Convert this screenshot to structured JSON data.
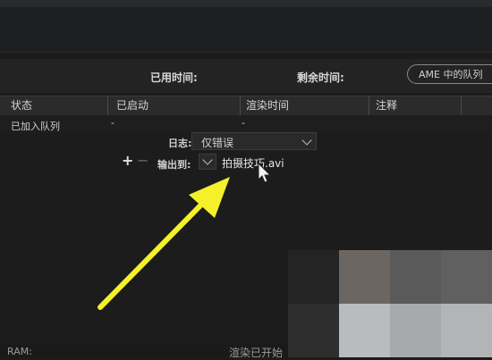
{
  "times": {
    "elapsed_label": "已用时间:",
    "remaining_label": "剩余时间:"
  },
  "ame_button": "AME 中的队列",
  "columns": [
    "状态",
    "已启动",
    "渲染时间",
    "注释"
  ],
  "row": {
    "status": "已加入队列",
    "started": "-",
    "render_time": "-"
  },
  "log": {
    "label": "日志:",
    "value": "仅错误"
  },
  "output": {
    "label": "输出到:",
    "filename": "拍摄技巧.avi"
  },
  "add_label": "+",
  "remove_label": "−",
  "status_bar": {
    "ram": "RAM:",
    "render_status": "渲染已开始"
  },
  "colors": {
    "background": "#1c1c1c",
    "arrow": "#f4f12a",
    "header": "#2b2b2b"
  },
  "icons": [
    "chevron-down-icon",
    "cursor-icon",
    "arrow-annotation-icon"
  ]
}
